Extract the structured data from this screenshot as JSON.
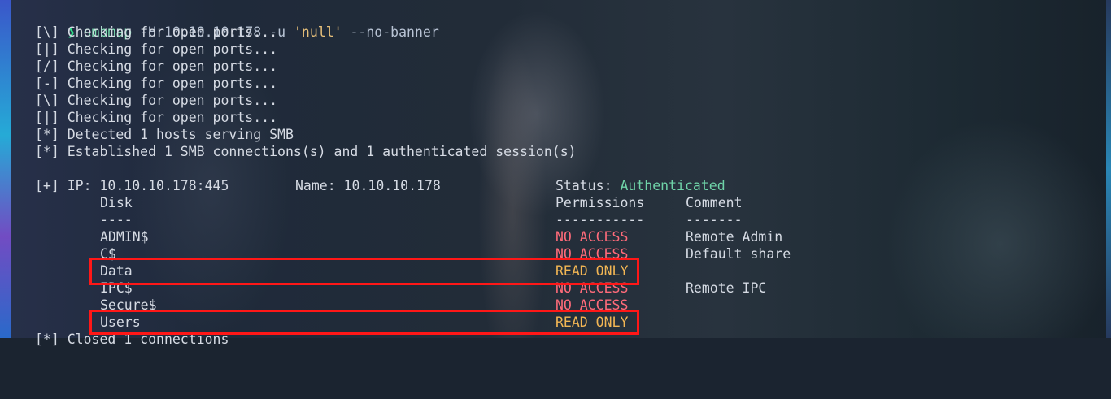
{
  "command": {
    "prompt_symbol": "❯",
    "program": "smbmap",
    "flag_host": "-H",
    "host": "10.10.10.178",
    "flag_user": "-u",
    "user_value": "'null'",
    "flag_banner": "--no-banner"
  },
  "output_lines": [
    "[\\] Checking for open ports...",
    "[|] Checking for open ports...",
    "[/] Checking for open ports...",
    "[-] Checking for open ports...",
    "[\\] Checking for open ports...",
    "[|] Checking for open ports...",
    "[*] Detected 1 hosts serving SMB",
    "[*] Established 1 SMB connections(s) and 1 authenticated session(s)"
  ],
  "host_info": {
    "ip_label": "[+] IP: 10.10.10.178:445",
    "name_label": "Name: 10.10.10.178",
    "status_label": "Status:",
    "status_value": "Authenticated"
  },
  "table": {
    "headers": {
      "disk": "Disk",
      "permissions": "Permissions",
      "comment": "Comment"
    },
    "underlines": {
      "disk": "----",
      "permissions": "-----------",
      "comment": "-------"
    },
    "rows": [
      {
        "disk": "ADMIN$",
        "permissions": "NO ACCESS",
        "perm_color": "#ff6b7a",
        "comment": "Remote Admin"
      },
      {
        "disk": "C$",
        "permissions": "NO ACCESS",
        "perm_color": "#ff6b7a",
        "comment": "Default share"
      },
      {
        "disk": "Data",
        "permissions": "READ ONLY",
        "perm_color": "#f2b654",
        "comment": ""
      },
      {
        "disk": "IPC$",
        "permissions": "NO ACCESS",
        "perm_color": "#ff6b7a",
        "comment": "Remote IPC"
      },
      {
        "disk": "Secure$",
        "permissions": "NO ACCESS",
        "perm_color": "#ff6b7a",
        "comment": ""
      },
      {
        "disk": "Users",
        "permissions": "READ ONLY",
        "perm_color": "#f2b654",
        "comment": ""
      }
    ]
  },
  "footer_line": "[*] Closed 1 connections",
  "colors": {
    "highlight_box": "#ff1717",
    "authenticated": "#6fd3a8",
    "no_access": "#ff6b7a",
    "read_only": "#f2b654"
  }
}
